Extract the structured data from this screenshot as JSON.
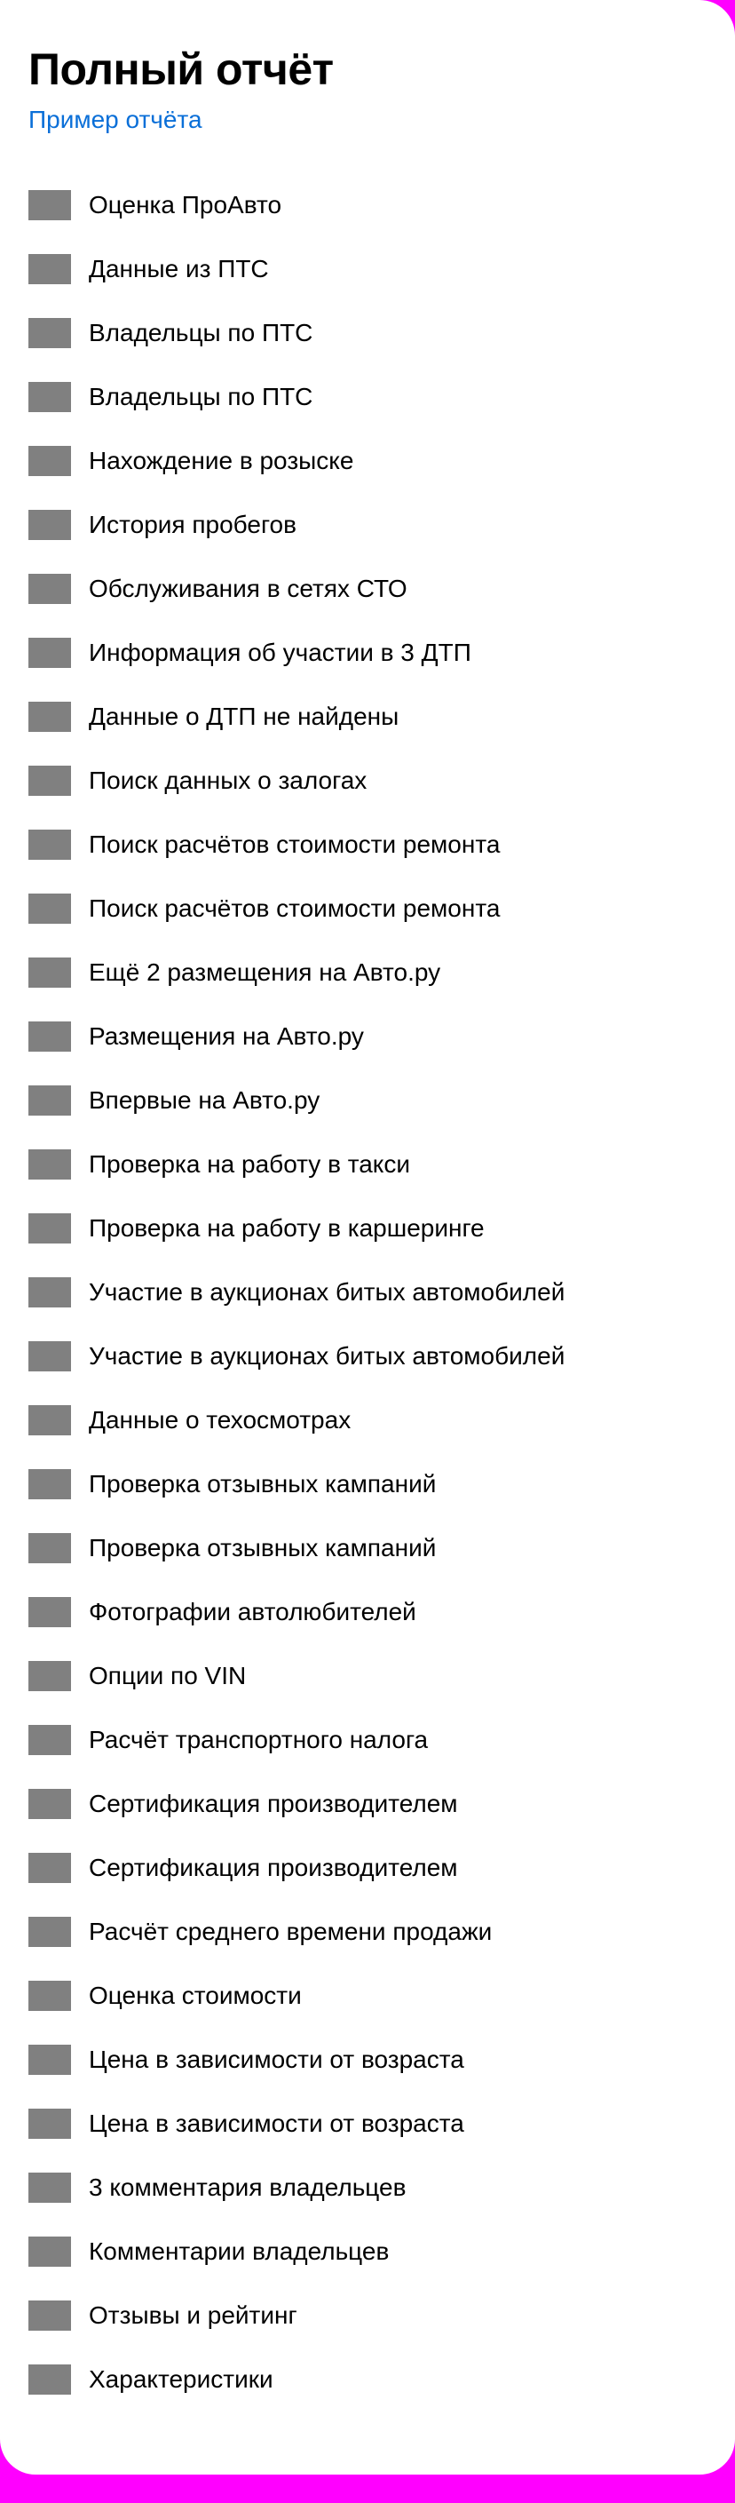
{
  "colors": {
    "accent_link": "#0a6fd8",
    "icon_placeholder": "#808080",
    "page_background": "#ff00ff"
  },
  "header": {
    "title": "Полный отчёт",
    "sample_link": "Пример отчёта"
  },
  "items": [
    {
      "label": "Оценка ПроАвто",
      "icon": "placeholder-icon"
    },
    {
      "label": "Данные из ПТС",
      "icon": "placeholder-icon"
    },
    {
      "label": "Владельцы по ПТС",
      "icon": "placeholder-icon"
    },
    {
      "label": "Владельцы по ПТС",
      "icon": "placeholder-icon"
    },
    {
      "label": "Нахождение в розыске",
      "icon": "placeholder-icon"
    },
    {
      "label": "История пробегов",
      "icon": "placeholder-icon"
    },
    {
      "label": "Обслуживания в сетях СТО",
      "icon": "placeholder-icon"
    },
    {
      "label": "Информация об участии в 3 ДТП",
      "icon": "placeholder-icon"
    },
    {
      "label": "Данные о ДТП не найдены",
      "icon": "placeholder-icon"
    },
    {
      "label": "Поиск данных о залогах",
      "icon": "placeholder-icon"
    },
    {
      "label": "Поиск расчётов стоимости ремонта",
      "icon": "placeholder-icon"
    },
    {
      "label": "Поиск расчётов стоимости ремонта",
      "icon": "placeholder-icon"
    },
    {
      "label": "Ещё 2 размещения на Авто.ру",
      "icon": "placeholder-icon"
    },
    {
      "label": "Размещения на Авто.ру",
      "icon": "placeholder-icon"
    },
    {
      "label": "Впервые на Авто.ру",
      "icon": "placeholder-icon"
    },
    {
      "label": "Проверка на работу в такси",
      "icon": "placeholder-icon"
    },
    {
      "label": "Проверка на работу в каршеринге",
      "icon": "placeholder-icon"
    },
    {
      "label": "Участие в аукционах битых автомобилей",
      "icon": "placeholder-icon"
    },
    {
      "label": "Участие в аукционах битых автомобилей",
      "icon": "placeholder-icon"
    },
    {
      "label": "Данные о техосмотрах",
      "icon": "placeholder-icon"
    },
    {
      "label": "Проверка отзывных кампаний",
      "icon": "placeholder-icon"
    },
    {
      "label": "Проверка отзывных кампаний",
      "icon": "placeholder-icon"
    },
    {
      "label": "Фотографии автолюбителей",
      "icon": "placeholder-icon"
    },
    {
      "label": "Опции по VIN",
      "icon": "placeholder-icon"
    },
    {
      "label": "Расчёт транспортного налога",
      "icon": "placeholder-icon"
    },
    {
      "label": "Сертификация производителем",
      "icon": "placeholder-icon"
    },
    {
      "label": "Сертификация производителем",
      "icon": "placeholder-icon"
    },
    {
      "label": "Расчёт среднего времени продажи",
      "icon": "placeholder-icon"
    },
    {
      "label": "Оценка стоимости",
      "icon": "placeholder-icon"
    },
    {
      "label": "Цена в зависимости от возраста",
      "icon": "placeholder-icon"
    },
    {
      "label": "Цена в зависимости от возраста",
      "icon": "placeholder-icon"
    },
    {
      "label": "3 комментария владельцев",
      "icon": "placeholder-icon"
    },
    {
      "label": "Комментарии владельцев",
      "icon": "placeholder-icon"
    },
    {
      "label": "Отзывы и рейтинг",
      "icon": "placeholder-icon"
    },
    {
      "label": "Характеристики",
      "icon": "placeholder-icon"
    }
  ]
}
